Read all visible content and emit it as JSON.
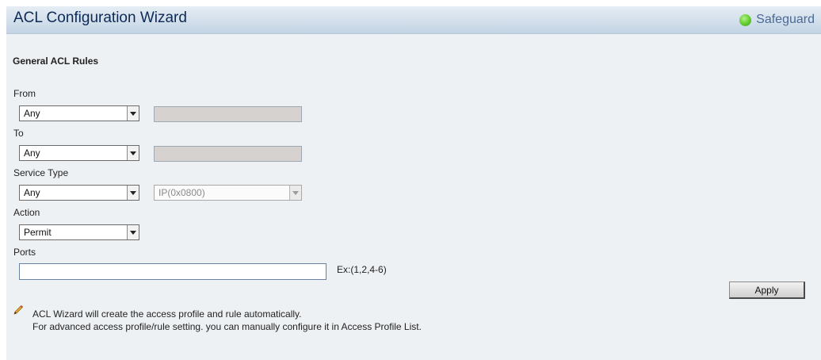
{
  "header": {
    "title": "ACL Configuration Wizard",
    "badge_label": "Safeguard",
    "badge_color": "#5fcc2c"
  },
  "form": {
    "section_title": "General ACL Rules",
    "from": {
      "label": "From",
      "selected": "Any"
    },
    "to": {
      "label": "To",
      "selected": "Any"
    },
    "service_type": {
      "label": "Service Type",
      "selected": "Any",
      "ethertype_selected": "IP(0x0800)"
    },
    "action": {
      "label": "Action",
      "selected": "Permit"
    },
    "ports": {
      "label": "Ports",
      "value": "",
      "hint": "Ex:(1,2,4-6)"
    }
  },
  "buttons": {
    "apply_label": "Apply"
  },
  "notes": {
    "line1": "ACL Wizard will create the access profile and rule automatically.",
    "line2": "For advanced access profile/rule setting. you can manually configure it in Access Profile List."
  },
  "icons": {
    "pencil": "pencil-icon",
    "dropdown": "chevron-down-icon",
    "status": "status-led-icon"
  }
}
